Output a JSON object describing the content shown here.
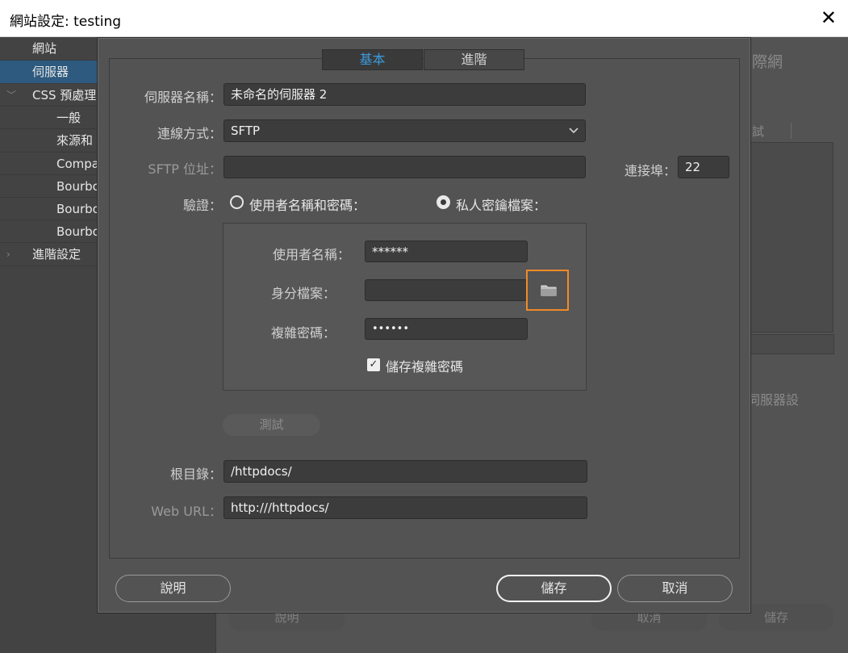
{
  "window": {
    "title": "網站設定: testing",
    "close_glyph": "✕"
  },
  "sidebar": {
    "items": [
      {
        "label": "網站"
      },
      {
        "label": "伺服器"
      },
      {
        "label": "CSS 預處理"
      },
      {
        "label": "一般"
      },
      {
        "label": "來源和"
      },
      {
        "label": "Compa"
      },
      {
        "label": "Bourbo"
      },
      {
        "label": "Bourbo"
      },
      {
        "label": "Bourbo"
      },
      {
        "label": "進階設定"
      }
    ],
    "selected_index": 1
  },
  "background": {
    "heading_fragment": "際網",
    "test_fragment": "試",
    "server_fragment": "伺服器設",
    "help_label": "說明",
    "cancel_label": "取消",
    "save_label": "儲存"
  },
  "dialog": {
    "tabs": [
      {
        "label": "基本",
        "active": true
      },
      {
        "label": "進階",
        "active": false
      }
    ],
    "server_name": {
      "label": "伺服器名稱：",
      "value": "未命名的伺服器 2"
    },
    "connection": {
      "label": "連線方式：",
      "value": "SFTP",
      "icon": "chevron-down-icon"
    },
    "sftp_address": {
      "label": "SFTP 位址：",
      "value": ""
    },
    "port": {
      "label": "連接埠：",
      "value": "22"
    },
    "auth": {
      "label": "驗證：",
      "option_password": "使用者名稱和密碼：",
      "option_keyfile": "私人密鑰檔案：",
      "selected": "keyfile"
    },
    "username": {
      "label": "使用者名稱：",
      "value": "******"
    },
    "identity_file": {
      "label": "身分檔案：",
      "value": "",
      "icon": "folder-icon"
    },
    "passphrase": {
      "label": "複雜密碼：",
      "value": "••••••"
    },
    "save_passphrase": {
      "label": "儲存複雜密碼",
      "checked": true,
      "glyph": "✓"
    },
    "test_button": "測試",
    "root_dir": {
      "label": "根目錄：",
      "value": "/httpdocs/"
    },
    "web_url": {
      "label": "Web URL：",
      "value": "http:///httpdocs/"
    },
    "help_button": "說明",
    "save_button": "儲存",
    "cancel_button": "取消"
  },
  "colors": {
    "accent_tab": "#3a9bdc",
    "highlight_border": "#f08a28",
    "selection": "#2d5a7e"
  }
}
